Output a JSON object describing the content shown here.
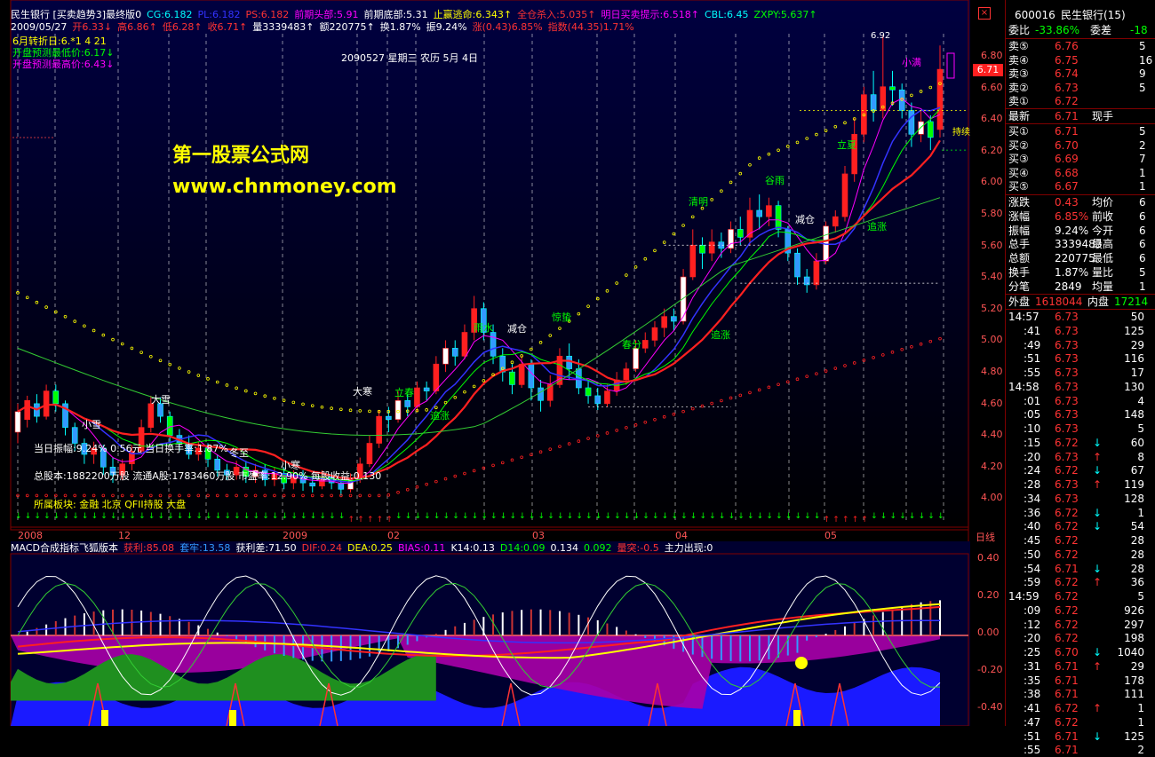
{
  "header": {
    "line1": [
      {
        "t": "民生银行 [买卖趋势3]最终版0",
        "c": "#ffffff"
      },
      {
        "t": "CG:6.182",
        "c": "#00ffff"
      },
      {
        "t": "PL:6.182",
        "c": "#3333ff"
      },
      {
        "t": "PS:6.182",
        "c": "#ff3333"
      },
      {
        "t": "前期头部:5.91",
        "c": "#ff00ff"
      },
      {
        "t": "前期底部:5.31",
        "c": "#ffffff"
      },
      {
        "t": "止赢逃命:6.343↑",
        "c": "#ffff00"
      },
      {
        "t": "全仓杀入:5.035↑",
        "c": "#ff3333"
      },
      {
        "t": "明日买卖提示:6.518↑",
        "c": "#ff00ff"
      },
      {
        "t": "CBL:6.45",
        "c": "#00ffff"
      },
      {
        "t": "ZXPY:5.637↑",
        "c": "#00ff00"
      }
    ],
    "line2": [
      {
        "t": "2009/05/27",
        "c": "#ffffff"
      },
      {
        "t": "开6.33↓",
        "c": "#ff3333"
      },
      {
        "t": "高6.86↑",
        "c": "#ff3333"
      },
      {
        "t": "低6.28↑",
        "c": "#ff3333"
      },
      {
        "t": "收6.71↑",
        "c": "#ff3333"
      },
      {
        "t": "量3339483↑",
        "c": "#ffffff"
      },
      {
        "t": "额220775↑",
        "c": "#ffffff"
      },
      {
        "t": "换1.87%",
        "c": "#ffffff"
      },
      {
        "t": "振9.24%",
        "c": "#ffffff"
      },
      {
        "t": "涨(0.43)6.85%",
        "c": "#ff3333"
      },
      {
        "t": "指数(44.35)1.71%",
        "c": "#ff3333"
      }
    ],
    "line3": "6月转折日:6.*1 4  21",
    "line4": "开盘预测最低价:6.17↓",
    "line5": "开盘预测最高价:6.43↓"
  },
  "watermark": {
    "name": "第一股票公式网",
    "url": "www.chnmoney.com"
  },
  "date_label": "2090527 星期三 农历 5月 4日",
  "solar_terms": [
    {
      "t": "小雪",
      "c": "#ffffff"
    },
    {
      "t": "大雪",
      "c": "#ffffff"
    },
    {
      "t": "冬至",
      "c": "#ffffff"
    },
    {
      "t": "小寒",
      "c": "#ffffff"
    },
    {
      "t": "大寒",
      "c": "#ffffff"
    },
    {
      "t": "立春",
      "c": "#00ff00"
    },
    {
      "t": "雨水",
      "c": "#00ff00"
    },
    {
      "t": "惊蛰",
      "c": "#00ff00"
    },
    {
      "t": "春分",
      "c": "#00ff00"
    },
    {
      "t": "清明",
      "c": "#00ff00"
    },
    {
      "t": "谷雨",
      "c": "#00ff00"
    },
    {
      "t": "立夏",
      "c": "#00ff00"
    },
    {
      "t": "小满",
      "c": "#ff00ff"
    }
  ],
  "signals": {
    "zhui": "追涨",
    "jian": "减仓",
    "zhui2": "追涨",
    "jian2": "减仓",
    "zhui3": "追涨",
    "zhui4": "追涨",
    "hold": "持续",
    "peak": "6.92"
  },
  "info": {
    "line1": "当日振幅:9.24%  0.56元  当日换手率:1.87%",
    "line2": "总股本:1882200万股 流通A股:1783460万股 市盈率:12.90% 每股收益:0.130",
    "line3": "所属板块: 金融  北京  QFII持股  大盘"
  },
  "time_axis": [
    "2008",
    "12",
    "2009",
    "02",
    "03",
    "04",
    "05"
  ],
  "price_axis": [
    "6.80",
    "6.60",
    "6.40",
    "6.20",
    "6.00",
    "5.80",
    "5.60",
    "5.40",
    "5.20",
    "5.00",
    "4.80",
    "4.60",
    "4.40",
    "4.20",
    "4.00"
  ],
  "price_tag": "6.71",
  "day_line": "日线",
  "indicator": {
    "title": "MACD合成指标飞狐版本",
    "items": [
      {
        "t": "获利:85.08",
        "c": "#ff3333"
      },
      {
        "t": "套牢:13.58",
        "c": "#3399ff"
      },
      {
        "t": "获利差:71.50",
        "c": "#ffffff"
      },
      {
        "t": "DIF:0.24",
        "c": "#ff3333"
      },
      {
        "t": "DEA:0.25",
        "c": "#ffff00"
      },
      {
        "t": "BIAS:0.11",
        "c": "#ff00ff"
      },
      {
        "t": "K14:0.13",
        "c": "#ffffff"
      },
      {
        "t": "D14:0.09",
        "c": "#00ff00"
      },
      {
        "t": "0.134",
        "c": "#ffffff"
      },
      {
        "t": "0.092",
        "c": "#00ff00"
      },
      {
        "t": "量突:-0.5",
        "c": "#ff3333"
      },
      {
        "t": "主力出现:0",
        "c": "#ffffff"
      }
    ],
    "axis": [
      "0.40",
      "0.20",
      "0.00",
      "-0.20",
      "-0.40"
    ]
  },
  "panel": {
    "code": "600016",
    "name": "民生银行(15)",
    "weibi_label": "委比",
    "weibi_val": "-33.86%",
    "weicha_label": "委差",
    "weicha_val": "-18",
    "asks": [
      {
        "l": "卖⑤",
        "p": "6.76",
        "v": "5"
      },
      {
        "l": "卖④",
        "p": "6.75",
        "v": "16"
      },
      {
        "l": "卖③",
        "p": "6.74",
        "v": "9"
      },
      {
        "l": "卖②",
        "p": "6.73",
        "v": "5"
      },
      {
        "l": "卖①",
        "p": "6.72",
        "v": ""
      }
    ],
    "last_label": "最新",
    "last_val": "6.71",
    "now_label": "现手",
    "bids": [
      {
        "l": "买①",
        "p": "6.71",
        "v": "5"
      },
      {
        "l": "买②",
        "p": "6.70",
        "v": "2"
      },
      {
        "l": "买③",
        "p": "6.69",
        "v": "7"
      },
      {
        "l": "买④",
        "p": "6.68",
        "v": "1"
      },
      {
        "l": "买⑤",
        "p": "6.67",
        "v": "1"
      }
    ],
    "stats": [
      {
        "a": "涨跌",
        "b": "0.43",
        "bc": "#ff3333",
        "c": "均价",
        "d": "6"
      },
      {
        "a": "涨幅",
        "b": "6.85%",
        "bc": "#ff3333",
        "c": "前收",
        "d": "6"
      },
      {
        "a": "振幅",
        "b": "9.24%",
        "bc": "#ffffff",
        "c": "今开",
        "d": "6"
      },
      {
        "a": "总手",
        "b": "3339483",
        "bc": "#ffffff",
        "c": "最高",
        "d": "6"
      },
      {
        "a": "总额",
        "b": "220775",
        "bc": "#ffffff",
        "c": "最低",
        "d": "6"
      },
      {
        "a": "换手",
        "b": "1.87%",
        "bc": "#ffffff",
        "c": "量比",
        "d": "5"
      },
      {
        "a": "分笔",
        "b": "2849",
        "bc": "#ffffff",
        "c": "均量",
        "d": "1"
      }
    ],
    "outer_label": "外盘",
    "outer_val": "1618044",
    "inner_label": "内盘",
    "inner_val": "17214",
    "ticks": [
      {
        "t": "14:57",
        "p": "6.73",
        "pc": "#ff3333",
        "v": "50",
        "a": ""
      },
      {
        "t": ":41",
        "p": "6.73",
        "pc": "#ff3333",
        "v": "125",
        "a": ""
      },
      {
        "t": ":49",
        "p": "6.73",
        "pc": "#ff3333",
        "v": "29",
        "a": ""
      },
      {
        "t": ":51",
        "p": "6.73",
        "pc": "#ff3333",
        "v": "116",
        "a": ""
      },
      {
        "t": ":55",
        "p": "6.73",
        "pc": "#ff3333",
        "v": "17",
        "a": ""
      },
      {
        "t": "14:58",
        "p": "6.73",
        "pc": "#ff3333",
        "v": "130",
        "a": ""
      },
      {
        "t": ":01",
        "p": "6.73",
        "pc": "#ff3333",
        "v": "4",
        "a": ""
      },
      {
        "t": ":05",
        "p": "6.73",
        "pc": "#ff3333",
        "v": "148",
        "a": ""
      },
      {
        "t": ":10",
        "p": "6.73",
        "pc": "#ff3333",
        "v": "5",
        "a": ""
      },
      {
        "t": ":15",
        "p": "6.72",
        "pc": "#ff3333",
        "v": "60",
        "a": "↓"
      },
      {
        "t": ":20",
        "p": "6.73",
        "pc": "#ff3333",
        "v": "8",
        "a": "↑"
      },
      {
        "t": ":24",
        "p": "6.72",
        "pc": "#ff3333",
        "v": "67",
        "a": "↓"
      },
      {
        "t": ":28",
        "p": "6.73",
        "pc": "#ff3333",
        "v": "119",
        "a": "↑"
      },
      {
        "t": ":34",
        "p": "6.73",
        "pc": "#ff3333",
        "v": "128",
        "a": ""
      },
      {
        "t": ":36",
        "p": "6.72",
        "pc": "#ff3333",
        "v": "1",
        "a": "↓"
      },
      {
        "t": ":40",
        "p": "6.72",
        "pc": "#ff3333",
        "v": "54",
        "a": "↓"
      },
      {
        "t": ":45",
        "p": "6.72",
        "pc": "#ff3333",
        "v": "28",
        "a": ""
      },
      {
        "t": ":50",
        "p": "6.72",
        "pc": "#ff3333",
        "v": "28",
        "a": ""
      },
      {
        "t": ":54",
        "p": "6.71",
        "pc": "#ff3333",
        "v": "28",
        "a": "↓"
      },
      {
        "t": ":59",
        "p": "6.72",
        "pc": "#ff3333",
        "v": "36",
        "a": "↑"
      },
      {
        "t": "14:59",
        "p": "6.72",
        "pc": "#ff3333",
        "v": "5",
        "a": ""
      },
      {
        "t": ":09",
        "p": "6.72",
        "pc": "#ff3333",
        "v": "926",
        "a": ""
      },
      {
        "t": ":12",
        "p": "6.72",
        "pc": "#ff3333",
        "v": "297",
        "a": ""
      },
      {
        "t": ":20",
        "p": "6.72",
        "pc": "#ff3333",
        "v": "198",
        "a": ""
      },
      {
        "t": ":25",
        "p": "6.70",
        "pc": "#ff3333",
        "v": "1040",
        "a": "↓"
      },
      {
        "t": ":31",
        "p": "6.71",
        "pc": "#ff3333",
        "v": "29",
        "a": "↑"
      },
      {
        "t": ":35",
        "p": "6.71",
        "pc": "#ff3333",
        "v": "178",
        "a": ""
      },
      {
        "t": ":38",
        "p": "6.71",
        "pc": "#ff3333",
        "v": "111",
        "a": ""
      },
      {
        "t": ":41",
        "p": "6.72",
        "pc": "#ff3333",
        "v": "1",
        "a": "↑"
      },
      {
        "t": ":47",
        "p": "6.72",
        "pc": "#ff3333",
        "v": "1",
        "a": ""
      },
      {
        "t": ":51",
        "p": "6.71",
        "pc": "#ff3333",
        "v": "125",
        "a": "↓"
      },
      {
        "t": ":55",
        "p": "6.71",
        "pc": "#ff3333",
        "v": "2",
        "a": ""
      }
    ]
  }
}
